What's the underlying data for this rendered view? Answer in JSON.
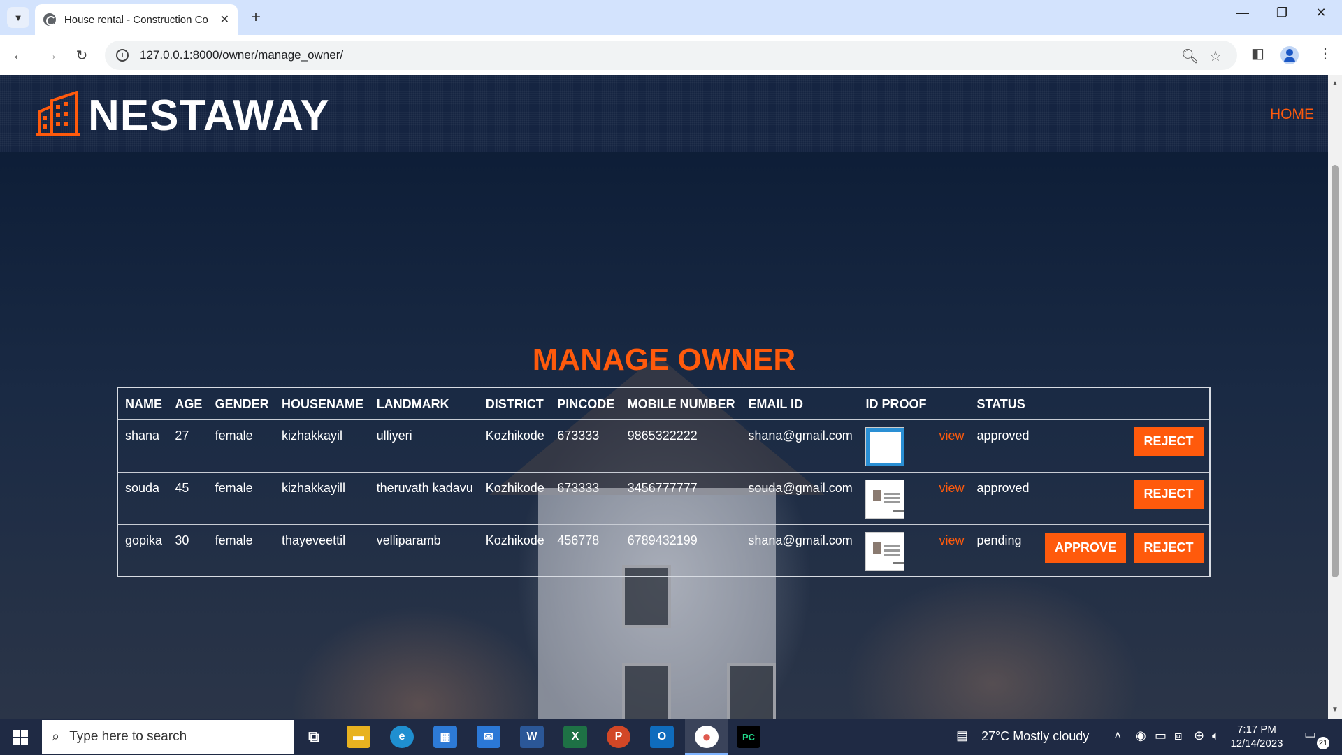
{
  "browser": {
    "tab_title": "House rental - Construction Co",
    "tab_close_glyph": "✕",
    "new_tab_glyph": "+",
    "url": "127.0.0.1:8000/owner/manage_owner/",
    "window_controls": {
      "minimize": "—",
      "restore": "❐",
      "close": "✕"
    }
  },
  "header": {
    "brand": "NESTAWAY",
    "nav_home": "HOME",
    "accent_color": "#ff5a0c"
  },
  "page": {
    "title": "MANAGE OWNER"
  },
  "table": {
    "columns": [
      "NAME",
      "AGE",
      "GENDER",
      "HOUSENAME",
      "LANDMARK",
      "DISTRICT",
      "PINCODE",
      "MOBILE NUMBER",
      "EMAIL ID",
      "ID PROOF",
      "STATUS"
    ],
    "rows": [
      {
        "name": "shana",
        "age": "27",
        "gender": "female",
        "housename": "kizhakkayil",
        "landmark": "ulliyeri",
        "district": "Kozhikode",
        "pincode": "673333",
        "mobile": "9865322222",
        "email": "shana@gmail.com",
        "view": "view",
        "status": "approved",
        "approve": "",
        "reject": "REJECT"
      },
      {
        "name": "souda",
        "age": "45",
        "gender": "female",
        "housename": "kizhakkayill",
        "landmark": "theruvath kadavu",
        "district": "Kozhikode",
        "pincode": "673333",
        "mobile": "3456777777",
        "email": "souda@gmail.com",
        "view": "view",
        "status": "approved",
        "approve": "",
        "reject": "REJECT"
      },
      {
        "name": "gopika",
        "age": "30",
        "gender": "female",
        "housename": "thayeveettil",
        "landmark": "velliparamb",
        "district": "Kozhikode",
        "pincode": "456778",
        "mobile": "6789432199",
        "email": "shana@gmail.com",
        "view": "view",
        "status": "pending",
        "approve": "APPROVE",
        "reject": "REJECT"
      }
    ]
  },
  "taskbar": {
    "search_placeholder": "Type here to search",
    "weather": "27°C  Mostly cloudy",
    "time": "7:17 PM",
    "date": "12/14/2023",
    "notification_count": "21",
    "apps": [
      {
        "name": "task-view",
        "glyph": "⧉",
        "color": "#1f2a44"
      },
      {
        "name": "file-explorer",
        "glyph": "▬",
        "color": "#e8b220"
      },
      {
        "name": "edge",
        "glyph": "e",
        "color": "#1f8fd0"
      },
      {
        "name": "store",
        "glyph": "▦",
        "color": "#2d7ad6"
      },
      {
        "name": "mail",
        "glyph": "✉",
        "color": "#2b78d6"
      },
      {
        "name": "word",
        "glyph": "W",
        "color": "#2b5797"
      },
      {
        "name": "excel",
        "glyph": "X",
        "color": "#1e7145"
      },
      {
        "name": "powerpoint",
        "glyph": "P",
        "color": "#d24726"
      },
      {
        "name": "outlook",
        "glyph": "O",
        "color": "#0f6cbd"
      },
      {
        "name": "chrome",
        "glyph": "●",
        "color": "#db4437"
      },
      {
        "name": "pycharm",
        "glyph": "PC",
        "color": "#21d789"
      }
    ]
  }
}
